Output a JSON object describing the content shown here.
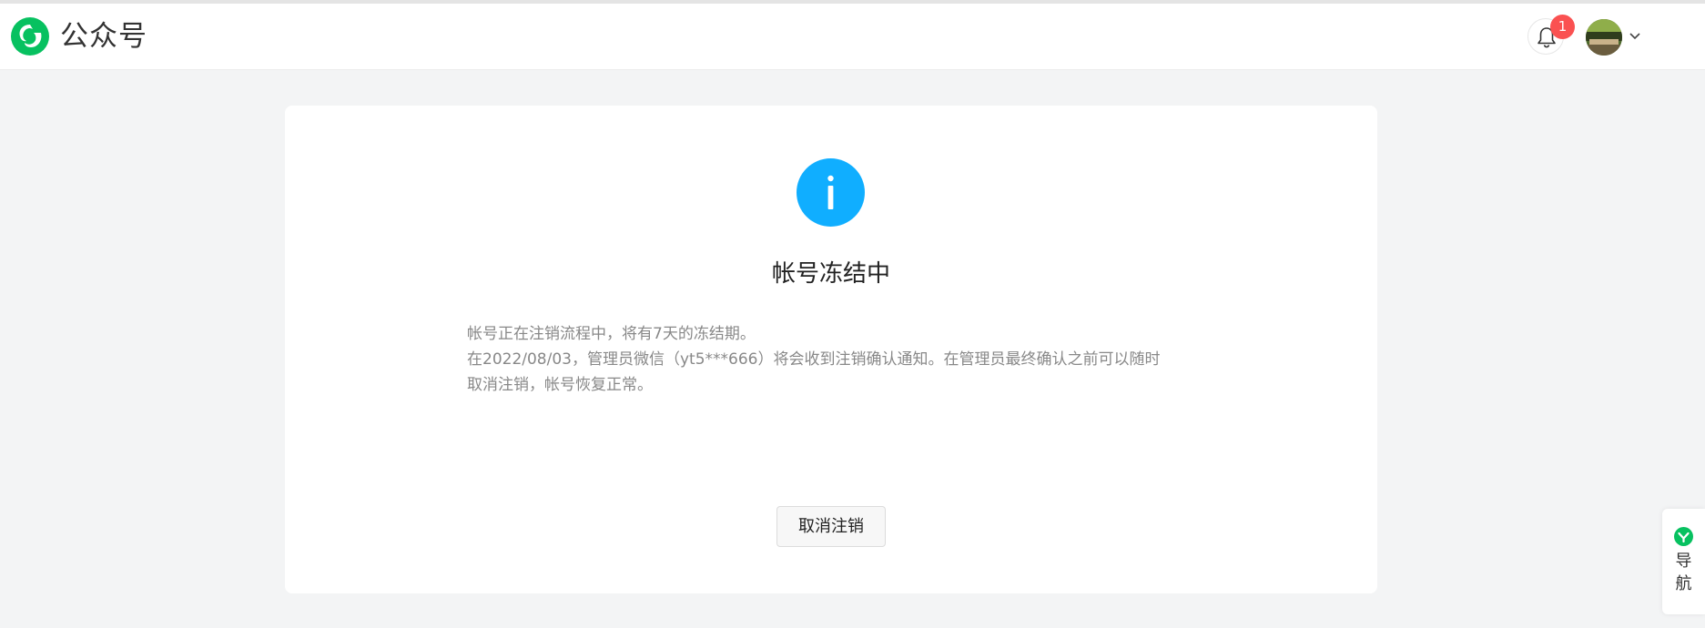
{
  "header": {
    "brand": "公众号",
    "notification_count": "1"
  },
  "notice": {
    "title": "帐号冻结中",
    "lines": [
      "帐号正在注销流程中，将有7天的冻结期。",
      "在2022/08/03，管理员微信（yt5***666）将会收到注销确认通知。在管理员最终确认之前可以随时",
      "取消注销，帐号恢复正常。"
    ],
    "cancel_button": "取消注销"
  },
  "side_nav": {
    "label_chars": [
      "导",
      "航"
    ]
  },
  "colors": {
    "brand_green": "#07c160",
    "info_blue": "#10aeff",
    "badge_red": "#fa5151",
    "page_bg": "#f3f4f5"
  },
  "icons": {
    "logo": "wechat-official-accounts-logo",
    "bell": "bell-icon",
    "info": "info-icon",
    "caret": "chevron-down-icon",
    "nav": "wechat-nav-icon"
  }
}
